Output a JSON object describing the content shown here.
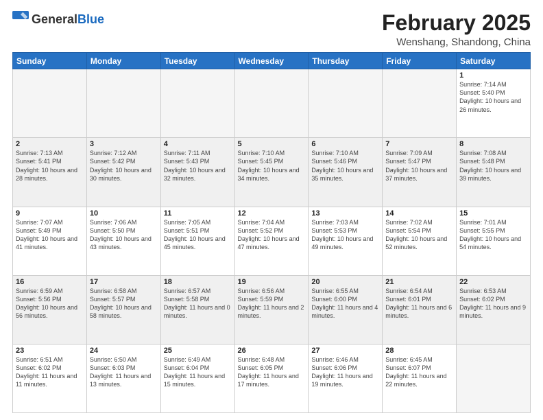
{
  "header": {
    "logo_general": "General",
    "logo_blue": "Blue",
    "month": "February 2025",
    "location": "Wenshang, Shandong, China"
  },
  "days_of_week": [
    "Sunday",
    "Monday",
    "Tuesday",
    "Wednesday",
    "Thursday",
    "Friday",
    "Saturday"
  ],
  "weeks": [
    [
      {
        "day": "",
        "info": ""
      },
      {
        "day": "",
        "info": ""
      },
      {
        "day": "",
        "info": ""
      },
      {
        "day": "",
        "info": ""
      },
      {
        "day": "",
        "info": ""
      },
      {
        "day": "",
        "info": ""
      },
      {
        "day": "1",
        "info": "Sunrise: 7:14 AM\nSunset: 5:40 PM\nDaylight: 10 hours and 26 minutes."
      }
    ],
    [
      {
        "day": "2",
        "info": "Sunrise: 7:13 AM\nSunset: 5:41 PM\nDaylight: 10 hours and 28 minutes."
      },
      {
        "day": "3",
        "info": "Sunrise: 7:12 AM\nSunset: 5:42 PM\nDaylight: 10 hours and 30 minutes."
      },
      {
        "day": "4",
        "info": "Sunrise: 7:11 AM\nSunset: 5:43 PM\nDaylight: 10 hours and 32 minutes."
      },
      {
        "day": "5",
        "info": "Sunrise: 7:10 AM\nSunset: 5:45 PM\nDaylight: 10 hours and 34 minutes."
      },
      {
        "day": "6",
        "info": "Sunrise: 7:10 AM\nSunset: 5:46 PM\nDaylight: 10 hours and 35 minutes."
      },
      {
        "day": "7",
        "info": "Sunrise: 7:09 AM\nSunset: 5:47 PM\nDaylight: 10 hours and 37 minutes."
      },
      {
        "day": "8",
        "info": "Sunrise: 7:08 AM\nSunset: 5:48 PM\nDaylight: 10 hours and 39 minutes."
      }
    ],
    [
      {
        "day": "9",
        "info": "Sunrise: 7:07 AM\nSunset: 5:49 PM\nDaylight: 10 hours and 41 minutes."
      },
      {
        "day": "10",
        "info": "Sunrise: 7:06 AM\nSunset: 5:50 PM\nDaylight: 10 hours and 43 minutes."
      },
      {
        "day": "11",
        "info": "Sunrise: 7:05 AM\nSunset: 5:51 PM\nDaylight: 10 hours and 45 minutes."
      },
      {
        "day": "12",
        "info": "Sunrise: 7:04 AM\nSunset: 5:52 PM\nDaylight: 10 hours and 47 minutes."
      },
      {
        "day": "13",
        "info": "Sunrise: 7:03 AM\nSunset: 5:53 PM\nDaylight: 10 hours and 49 minutes."
      },
      {
        "day": "14",
        "info": "Sunrise: 7:02 AM\nSunset: 5:54 PM\nDaylight: 10 hours and 52 minutes."
      },
      {
        "day": "15",
        "info": "Sunrise: 7:01 AM\nSunset: 5:55 PM\nDaylight: 10 hours and 54 minutes."
      }
    ],
    [
      {
        "day": "16",
        "info": "Sunrise: 6:59 AM\nSunset: 5:56 PM\nDaylight: 10 hours and 56 minutes."
      },
      {
        "day": "17",
        "info": "Sunrise: 6:58 AM\nSunset: 5:57 PM\nDaylight: 10 hours and 58 minutes."
      },
      {
        "day": "18",
        "info": "Sunrise: 6:57 AM\nSunset: 5:58 PM\nDaylight: 11 hours and 0 minutes."
      },
      {
        "day": "19",
        "info": "Sunrise: 6:56 AM\nSunset: 5:59 PM\nDaylight: 11 hours and 2 minutes."
      },
      {
        "day": "20",
        "info": "Sunrise: 6:55 AM\nSunset: 6:00 PM\nDaylight: 11 hours and 4 minutes."
      },
      {
        "day": "21",
        "info": "Sunrise: 6:54 AM\nSunset: 6:01 PM\nDaylight: 11 hours and 6 minutes."
      },
      {
        "day": "22",
        "info": "Sunrise: 6:53 AM\nSunset: 6:02 PM\nDaylight: 11 hours and 9 minutes."
      }
    ],
    [
      {
        "day": "23",
        "info": "Sunrise: 6:51 AM\nSunset: 6:02 PM\nDaylight: 11 hours and 11 minutes."
      },
      {
        "day": "24",
        "info": "Sunrise: 6:50 AM\nSunset: 6:03 PM\nDaylight: 11 hours and 13 minutes."
      },
      {
        "day": "25",
        "info": "Sunrise: 6:49 AM\nSunset: 6:04 PM\nDaylight: 11 hours and 15 minutes."
      },
      {
        "day": "26",
        "info": "Sunrise: 6:48 AM\nSunset: 6:05 PM\nDaylight: 11 hours and 17 minutes."
      },
      {
        "day": "27",
        "info": "Sunrise: 6:46 AM\nSunset: 6:06 PM\nDaylight: 11 hours and 19 minutes."
      },
      {
        "day": "28",
        "info": "Sunrise: 6:45 AM\nSunset: 6:07 PM\nDaylight: 11 hours and 22 minutes."
      },
      {
        "day": "",
        "info": ""
      }
    ]
  ]
}
